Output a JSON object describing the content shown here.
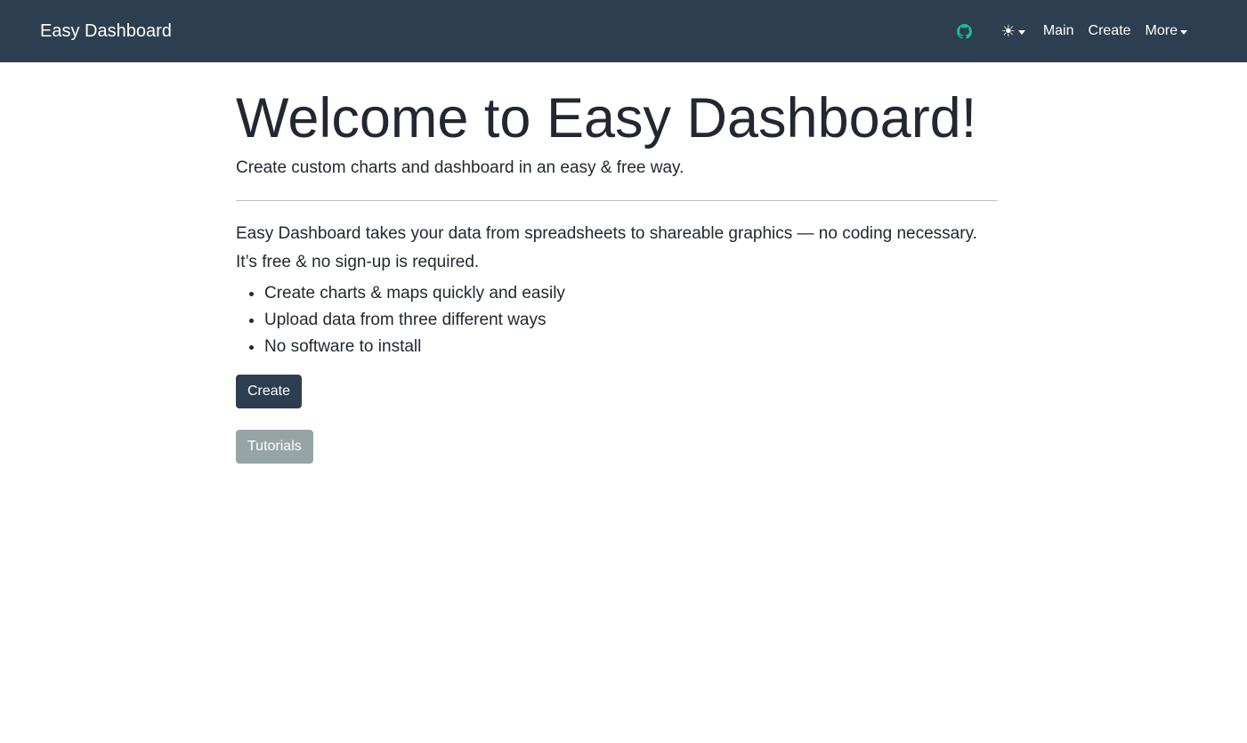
{
  "navbar": {
    "brand": "Easy Dashboard",
    "github_icon": "github-icon",
    "github_color": "#18bc9c",
    "theme_icon": "☀",
    "theme_icon_name": "sun-icon",
    "links": {
      "main": "Main",
      "create": "Create",
      "more": "More"
    },
    "background": "#2c3e50"
  },
  "main": {
    "title": "Welcome to Easy Dashboard!",
    "lead": "Create custom charts and dashboard in an easy & free way.",
    "intro_line1": "Easy Dashboard takes your data from spreadsheets to shareable graphics — no coding necessary.",
    "intro_line2": "It’s free & no sign-up is required.",
    "features": [
      "Create charts & maps quickly and easily",
      "Upload data from three different ways",
      "No software to install"
    ],
    "buttons": {
      "create": "Create",
      "tutorials": "Tutorials"
    }
  },
  "colors": {
    "primary": "#2c3e50",
    "secondary": "#95a5a6",
    "accent": "#18bc9c"
  }
}
